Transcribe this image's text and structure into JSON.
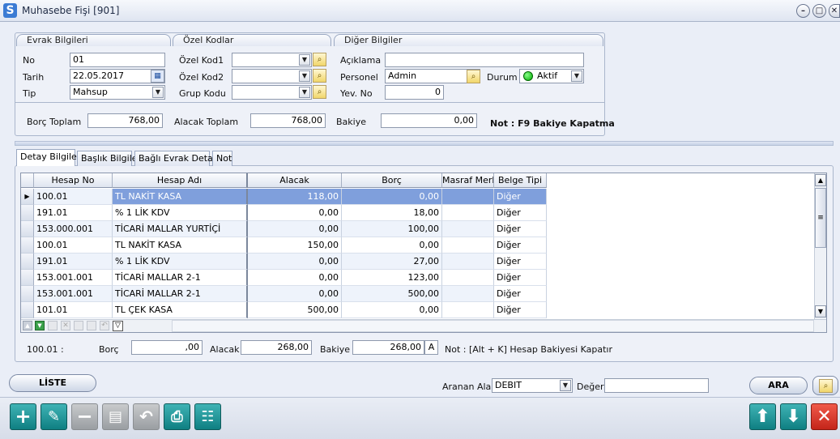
{
  "window": {
    "title": "Muhasebe Fişi  [901]",
    "logo": "S",
    "minimize": "–",
    "maximize": "□",
    "close": "✕"
  },
  "evrak": {
    "header": "Evrak Bilgileri",
    "no_label": "No",
    "no_value": "01",
    "tarih_label": "Tarih",
    "tarih_value": "22.05.2017",
    "tip_label": "Tip",
    "tip_value": "Mahsup"
  },
  "ozel": {
    "header": "Özel Kodlar",
    "kod1_label": "Özel Kod1",
    "kod1_value": "",
    "kod2_label": "Özel Kod2",
    "kod2_value": "",
    "grup_label": "Grup Kodu",
    "grup_value": ""
  },
  "diger": {
    "header": "Diğer Bilgiler",
    "aciklama_label": "Açıklama",
    "aciklama_value": "",
    "personel_label": "Personel",
    "personel_value": "Admin",
    "durum_label": "Durum",
    "durum_value": "Aktif",
    "yevno_label": "Yev. No",
    "yevno_value": "0"
  },
  "totals": {
    "borc_label": "Borç Toplam",
    "borc_value": "768,00",
    "alacak_label": "Alacak Toplam",
    "alacak_value": "768,00",
    "bakiye_label": "Bakiye",
    "bakiye_value": "0,00",
    "note": "Not : F9 Bakiye Kapatma"
  },
  "tabs": [
    "Detay Bilgileri",
    "Başlık Bilgileri",
    "Bağlı Evrak Detayı",
    "Not"
  ],
  "grid": {
    "columns": [
      "Hesap No",
      "Hesap Adı",
      "Alacak",
      "Borç",
      "Masraf Merk",
      "Belge Tipi"
    ],
    "rows": [
      [
        "100.01",
        "TL NAKİT KASA",
        "118,00",
        "0,00",
        "",
        "Diğer"
      ],
      [
        "191.01",
        "% 1 LİK KDV",
        "0,00",
        "18,00",
        "",
        "Diğer"
      ],
      [
        "153.000.001",
        "TİCARİ MALLAR YURTİÇİ",
        "0,00",
        "100,00",
        "",
        "Diğer"
      ],
      [
        "100.01",
        "TL NAKİT KASA",
        "150,00",
        "0,00",
        "",
        "Diğer"
      ],
      [
        "191.01",
        "% 1 LİK KDV",
        "0,00",
        "27,00",
        "",
        "Diğer"
      ],
      [
        "153.001.001",
        "TİCARİ MALLAR 2-1",
        "0,00",
        "123,00",
        "",
        "Diğer"
      ],
      [
        "153.001.001",
        "TİCARİ MALLAR 2-1",
        "0,00",
        "500,00",
        "",
        "Diğer"
      ],
      [
        "101.01",
        "TL ÇEK KASA",
        "500,00",
        "0,00",
        "",
        "Diğer"
      ]
    ]
  },
  "account_summary": {
    "account": "100.01 :",
    "borc_label": "Borç",
    "borc_value": ",00",
    "alacak_label": "Alacak",
    "alacak_value": "268,00",
    "bakiye_label": "Bakiye",
    "bakiye_value": "268,00",
    "bakiye_side": "A",
    "note": "Not : [Alt + K] Hesap Bakiyesi Kapatır"
  },
  "search": {
    "liste_label": "LİSTE",
    "field_label": "Aranan Alan",
    "field_value": "DEBIT",
    "value_label": "Değer",
    "value_value": "",
    "ara_label": "ARA"
  },
  "colors": {
    "accent": "#0f7f82",
    "selected_row": "#7f9fdc",
    "danger": "#c4251a"
  }
}
